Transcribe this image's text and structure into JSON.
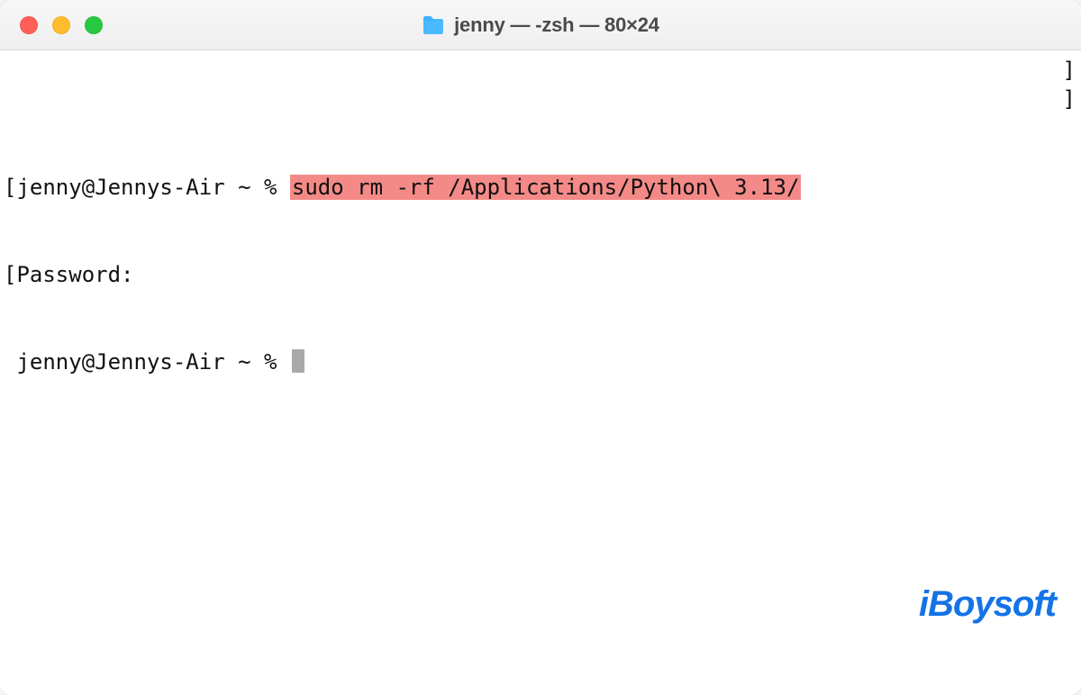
{
  "window": {
    "title": "jenny — -zsh — 80×24"
  },
  "terminal": {
    "line1": {
      "open_bracket": "[",
      "prompt": "jenny@Jennys-Air ~ % ",
      "command_highlighted": "sudo rm -rf /Applications/Python\\ 3.13/",
      "close_bracket": "]"
    },
    "line2": {
      "open_bracket": "[",
      "text": "Password:",
      "close_bracket": "]"
    },
    "line3": {
      "prompt": " jenny@Jennys-Air ~ % "
    }
  },
  "watermark": {
    "text": "iBoysoft"
  },
  "colors": {
    "highlight_bg": "#f48a88",
    "brand": "#1473e6"
  }
}
